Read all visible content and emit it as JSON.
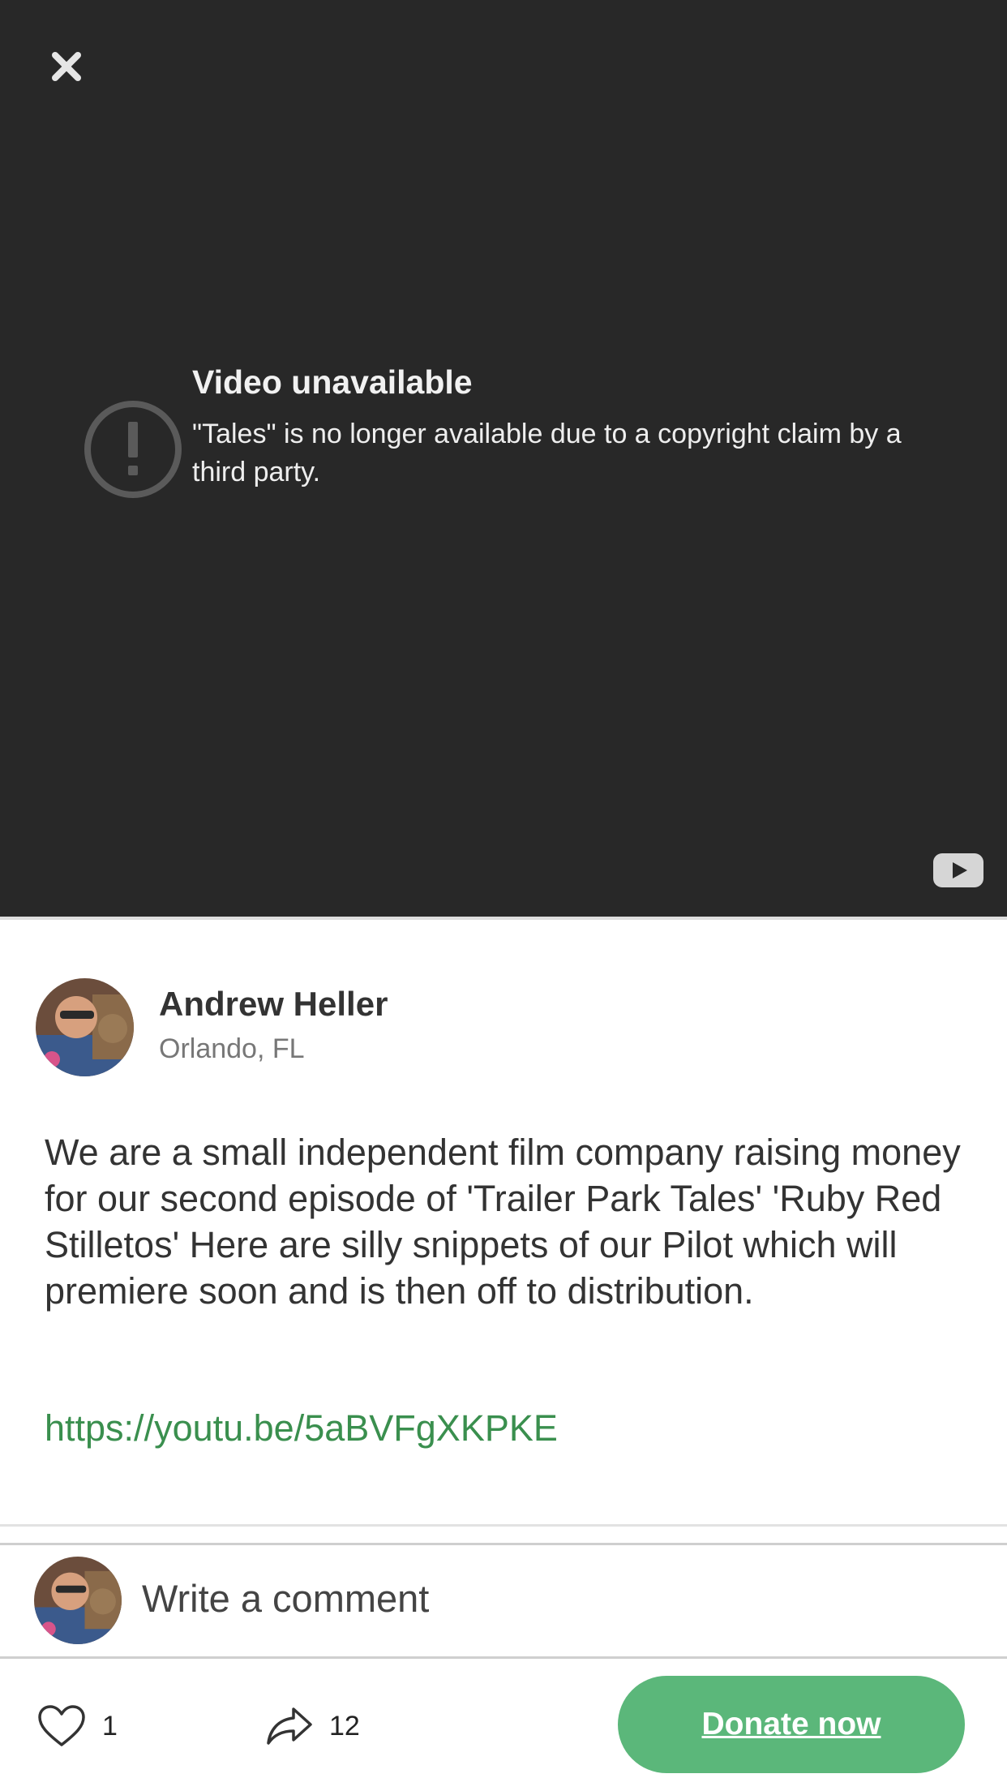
{
  "video": {
    "error_title": "Video unavailable",
    "error_message": "\"Tales\" is no longer available due to a copyright claim by a third party.",
    "close_icon": "close-icon",
    "status_icon": "exclamation-circle-icon",
    "logo_icon": "youtube-logo-icon"
  },
  "author": {
    "name": "Andrew Heller",
    "location": "Orlando, FL"
  },
  "post": {
    "description": "We are a small independent film company raising money for our second episode of 'Trailer Park Tales' 'Ruby Red Stilletos' Here are silly snippets of our Pilot which will premiere soon and is then off to distribution.",
    "link": "https://youtu.be/5aBVFgXKPKE"
  },
  "comment": {
    "placeholder": "Write a comment"
  },
  "actions": {
    "like_count": "1",
    "share_count": "12",
    "donate_label": "Donate now"
  },
  "colors": {
    "video_bg": "#282828",
    "accent_green": "#5bb77a",
    "link_green": "#3a8f4e"
  }
}
